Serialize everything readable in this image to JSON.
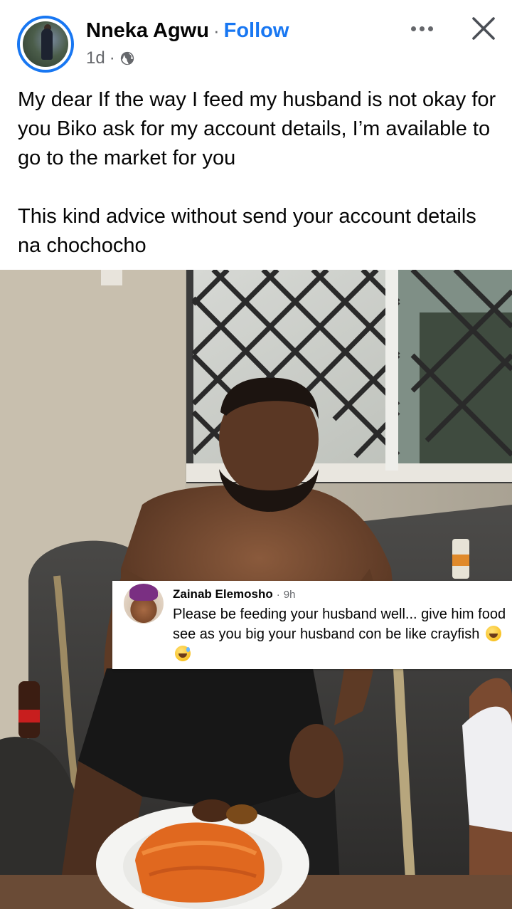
{
  "post": {
    "author": "Nneka Agwu",
    "separator": "·",
    "follow_label": "Follow",
    "timestamp": "1d",
    "meta_separator": "·",
    "audience_icon": "globe-icon",
    "text_line_1": "My dear If the way I feed my husband is not okay for you Biko ask for my account details, I’m available to go to the market for you",
    "text_line_2": "This kind advice without send your account details na chochocho"
  },
  "header_actions": {
    "more_icon": "more-options-icon",
    "close_icon": "close-icon"
  },
  "comment": {
    "name": "Zainab Elemosho",
    "separator": "·",
    "time": "9h",
    "text": "Please be feeding your husband well... give him food see as you big your husband con be like crayfish",
    "emojis": [
      "laughing-tears-emoji",
      "grinning-sweat-emoji"
    ]
  },
  "colors": {
    "accent": "#1877f2",
    "secondary_text": "#65676b",
    "primary_text": "#050505"
  }
}
